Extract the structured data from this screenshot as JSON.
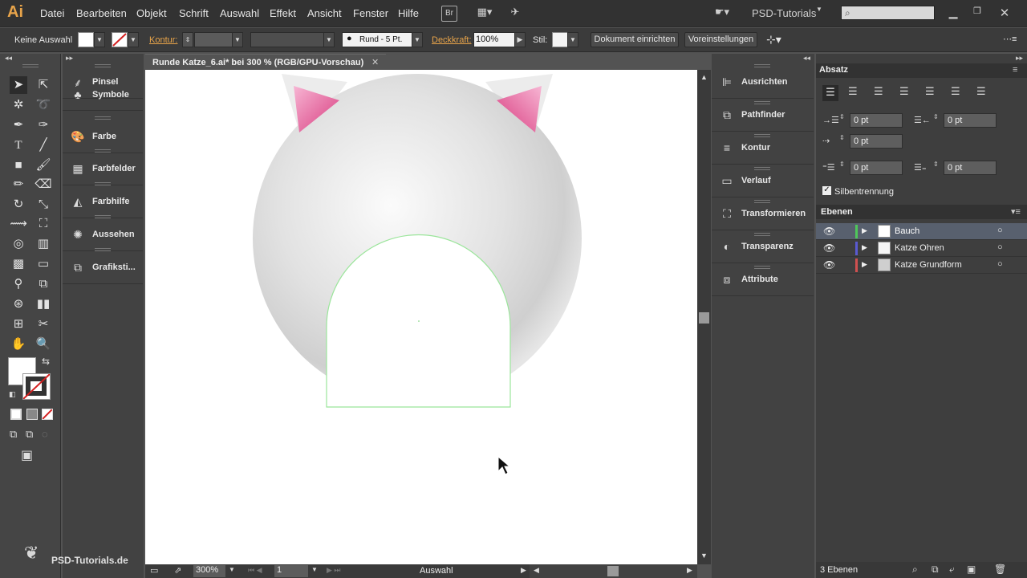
{
  "app": {
    "logo": "Ai",
    "workspace": "PSD-Tutorials"
  },
  "menu": [
    "Datei",
    "Bearbeiten",
    "Objekt",
    "Schrift",
    "Auswahl",
    "Effekt",
    "Ansicht",
    "Fenster",
    "Hilfe"
  ],
  "menu_icons": {
    "bridge": "Br"
  },
  "control_bar": {
    "selection": "Keine Auswahl",
    "stroke_label": "Kontur:",
    "brush_label": "Rund - 5 Pt.",
    "opacity_label": "Deckkraft:",
    "opacity_value": "100%",
    "style_label": "Stil:",
    "doc_setup": "Dokument einrichten",
    "preferences": "Voreinstellungen"
  },
  "document": {
    "tab_title": "Runde Katze_6.ai* bei 300 % (RGB/GPU-Vorschau)",
    "zoom": "300%",
    "artboard": "1",
    "status_tool": "Auswahl"
  },
  "panels_left": [
    "Pinsel",
    "Symbole",
    "Farbe",
    "Farbfelder",
    "Farbhilfe",
    "Aussehen",
    "Grafiksti..."
  ],
  "panels_right": [
    "Ausrichten",
    "Pathfinder",
    "Kontur",
    "Verlauf",
    "Transformieren",
    "Transparenz",
    "Attribute"
  ],
  "paragraph": {
    "title": "Absatz",
    "indent_left": "0 pt",
    "indent_right": "0 pt",
    "indent_first": "0 pt",
    "space_before": "0 pt",
    "space_after": "0 pt",
    "hyphenation": "Silbentrennung"
  },
  "layers": {
    "title": "Ebenen",
    "count": "3 Ebenen",
    "items": [
      {
        "name": "Bauch",
        "color": "#4fc75a",
        "selected": true
      },
      {
        "name": "Katze Ohren",
        "color": "#5a5ad0",
        "selected": false
      },
      {
        "name": "Katze Grundform",
        "color": "#d05050",
        "selected": false
      }
    ]
  },
  "watermark": "PSD-Tutorials.de",
  "colors": {
    "accent_orange": "#e8a44a",
    "ear_pink": "#e04a8a",
    "selection_green": "#8fe28f"
  }
}
